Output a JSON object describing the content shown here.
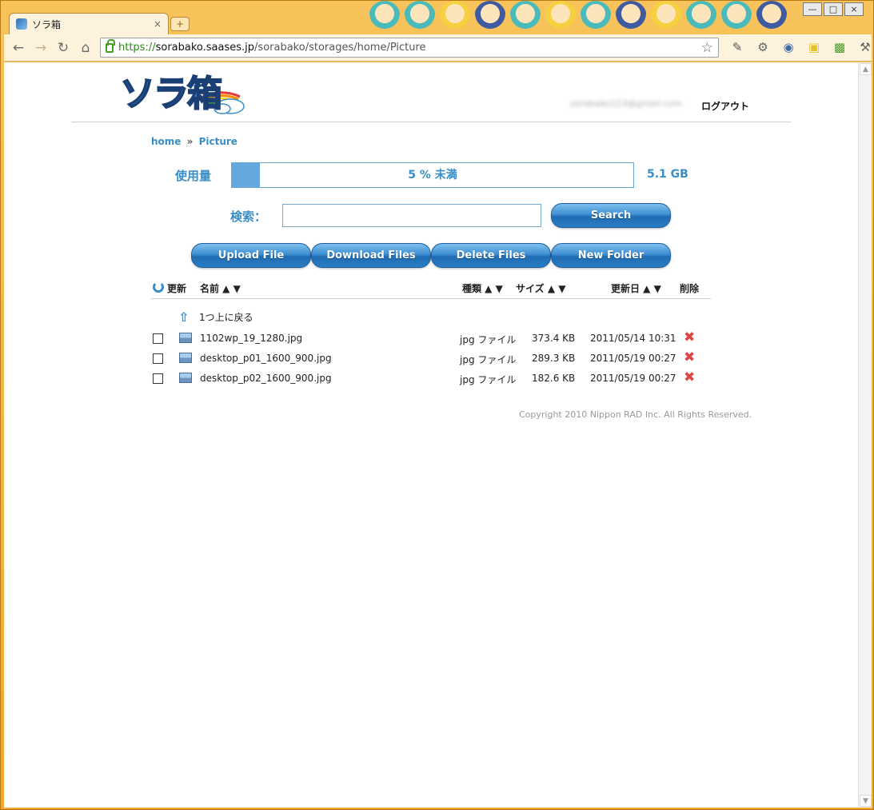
{
  "browser": {
    "tab_title": "ソラ箱",
    "tab_close": "×",
    "new_tab": "+",
    "url_scheme": "https://",
    "url_host": "sorabako.saases.jp",
    "url_path": "/sorabako/storages/home/Picture",
    "window_controls": [
      "—",
      "□",
      "×"
    ]
  },
  "header": {
    "logo_text": "ソラ箱",
    "user_email": "sorabako123@gmail.com",
    "logout": "ログアウト"
  },
  "breadcrumb": {
    "home": "home",
    "separator": "»",
    "current": "Picture"
  },
  "usage": {
    "label": "使用量",
    "text": "5 % 未満",
    "fill_percent": 7,
    "total": "5.1 GB",
    "fill_color": "#64a8de"
  },
  "search": {
    "label": "検索：",
    "value": "",
    "button": "Search"
  },
  "actions": {
    "upload": "Upload File",
    "download": "Download Files",
    "delete": "Delete Files",
    "new_folder": "New Folder"
  },
  "table": {
    "refresh": "更新",
    "name": "名前 ▲ ▼",
    "type": "種類 ▲ ▼",
    "size": "サイズ ▲ ▼",
    "date": "更新日 ▲ ▼",
    "delete": "削除",
    "up_label": "1つ上に戻る",
    "rows": [
      {
        "name": "1102wp_19_1280.jpg",
        "type": "jpg ファイル",
        "size": "373.4 KB",
        "date": "2011/05/14 10:31"
      },
      {
        "name": "desktop_p01_1600_900.jpg",
        "type": "jpg ファイル",
        "size": "289.3 KB",
        "date": "2011/05/19 00:27"
      },
      {
        "name": "desktop_p02_1600_900.jpg",
        "type": "jpg ファイル",
        "size": "182.6 KB",
        "date": "2011/05/19 00:27"
      }
    ]
  },
  "footer": {
    "copyright": "Copyright 2010 Nippon RAD Inc. All Rights Reserved."
  }
}
